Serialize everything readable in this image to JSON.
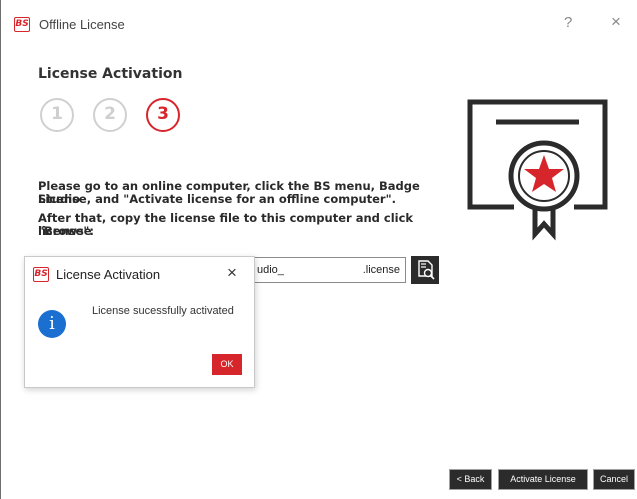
{
  "window": {
    "logo_text": "BS",
    "title": "Offline License",
    "help_label": "?",
    "close_label": "×"
  },
  "page": {
    "heading": "License Activation",
    "steps": [
      "1",
      "2",
      "3"
    ],
    "active_step": 3,
    "instruction_line1": "Please go to an online computer, click the BS menu, Badge Studio",
    "instruction_line2": "License, and \"Activate license for an offline computer\".",
    "instruction_line3": "After that, copy the license file to this computer and click \"Browse",
    "instruction_line4": "license\":"
  },
  "license_field": {
    "value_start": "udio_",
    "value_end": ".license"
  },
  "popup": {
    "logo_text": "BS",
    "title": "License Activation",
    "close_label": "×",
    "info_symbol": "i",
    "message": "License sucessfully activated",
    "ok_label": "OK"
  },
  "footer": {
    "back_label": "< Back",
    "activate_label": "Activate License",
    "cancel_label": "Cancel"
  },
  "icons": {
    "browse": "file-search-icon",
    "certificate": "certificate-icon",
    "info": "info-icon"
  },
  "colors": {
    "accent": "#d7262b",
    "dark": "#2b2b2b",
    "step_inactive": "#d0d0d0",
    "info_blue": "#1a6fd1"
  }
}
